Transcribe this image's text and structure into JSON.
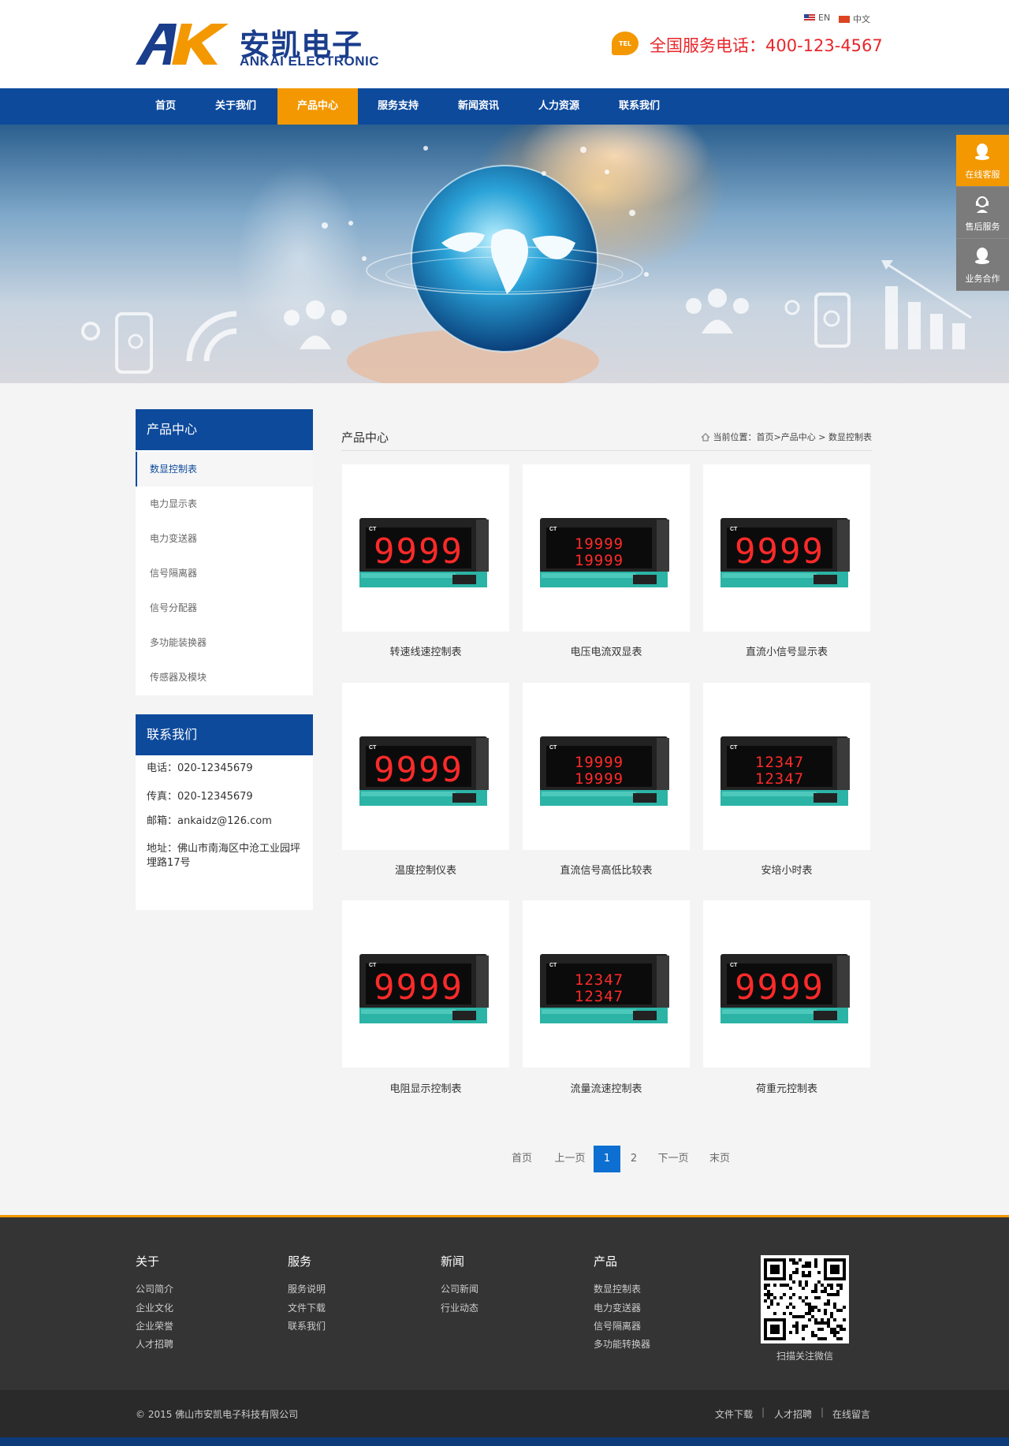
{
  "header": {
    "logo_mark": "AK",
    "logo_cn": "安凯电子",
    "logo_en": "ANKAI ELECTRONIC",
    "lang_en": "EN",
    "lang_cn": "中文",
    "tel_badge": "TEL",
    "hotline": "全国服务电话：400-123-4567"
  },
  "nav": [
    "首页",
    "关于我们",
    "产品中心",
    "服务支持",
    "新闻资讯",
    "人力资源",
    "联系我们"
  ],
  "float_panel": [
    "在线客服",
    "售后服务",
    "业务合作"
  ],
  "sidebar": {
    "products_title": "产品中心",
    "products": [
      "数显控制表",
      "电力显示表",
      "电力变送器",
      "信号隔离器",
      "信号分配器",
      "多功能装换器",
      "传感器及模块"
    ],
    "contact_title": "联系我们",
    "phone": "电话：020-12345679",
    "fax": "传真：020-12345679",
    "email": "邮箱：ankaidz@126.com",
    "address_1": "地址：佛山市南海区中沧工业园坪",
    "address_2": "埋路17号"
  },
  "main": {
    "title": "产品中心",
    "breadcrumb": "当前位置：首页>产品中心 > 数显控制表",
    "products": [
      {
        "name": "转速线速控制表",
        "display": "9999"
      },
      {
        "name": "电压电流双显表",
        "display": "19999"
      },
      {
        "name": "直流小信号显示表",
        "display": "9999"
      },
      {
        "name": "温度控制仪表",
        "display": "9999"
      },
      {
        "name": "直流信号高低比较表",
        "display": "19999"
      },
      {
        "name": "安培小时表",
        "display": "12347"
      },
      {
        "name": "电阻显示控制表",
        "display": "9999"
      },
      {
        "name": "流量流速控制表",
        "display": "12347"
      },
      {
        "name": "荷重元控制表",
        "display": "9999"
      }
    ]
  },
  "pagination": {
    "first": "首页",
    "prev": "上一页",
    "page1": "1",
    "page2": "2",
    "next": "下一页",
    "last": "末页"
  },
  "footer": {
    "about": {
      "title": "关于",
      "links": [
        "公司简介",
        "企业文化",
        "企业荣誉",
        "人才招聘"
      ]
    },
    "service": {
      "title": "服务",
      "links": [
        "服务说明",
        "文件下载",
        "联系我们"
      ]
    },
    "news": {
      "title": "新闻",
      "links": [
        "公司新闻",
        "行业动态"
      ]
    },
    "products": {
      "title": "产品",
      "links": [
        "数显控制表",
        "电力变送器",
        "信号隔离器",
        "多功能转换器"
      ]
    },
    "qr_caption": "扫描关注微信",
    "copyright": "© 2015 佛山市安凯电子科技有限公司",
    "bottom_links": [
      "文件下载",
      "人才招聘",
      "在线留言"
    ]
  },
  "colors": {
    "primary": "#0d4a9c",
    "accent": "#f39800",
    "hotline": "#e8262a",
    "footer": "#343434"
  }
}
